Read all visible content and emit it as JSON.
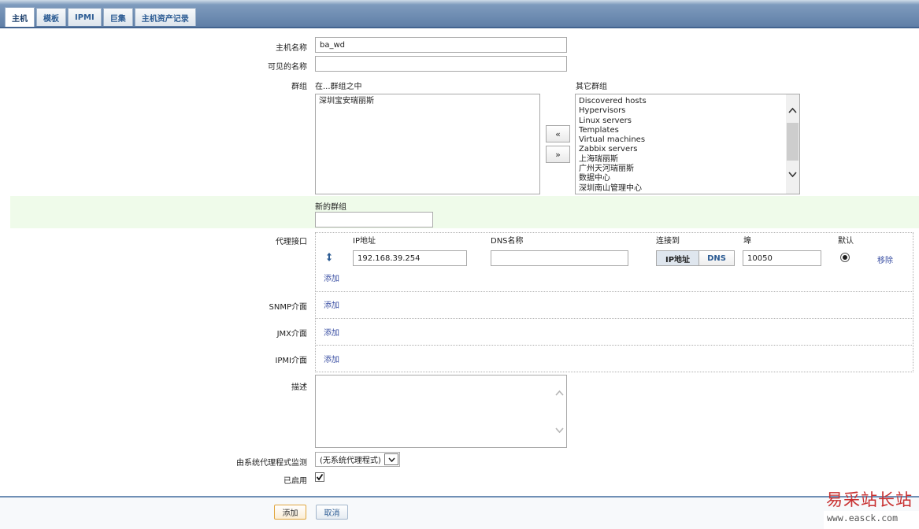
{
  "tabs": [
    "主机",
    "模板",
    "IPMI",
    "巨集",
    "主机资产记录"
  ],
  "form": {
    "host_name_label": "主机名称",
    "host_name_value": "ba_wd",
    "visible_name_label": "可见的名称",
    "visible_name_value": "",
    "groups_label": "群组",
    "in_groups_label": "在...群组之中",
    "in_groups": [
      "深圳宝安瑞丽斯"
    ],
    "other_groups_label": "其它群组",
    "other_groups": [
      "Discovered hosts",
      "Hypervisors",
      "Linux servers",
      "Templates",
      "Virtual machines",
      "Zabbix servers",
      "上海瑞丽斯",
      "广州天河瑞丽斯",
      "数据中心",
      "深圳南山管理中心"
    ],
    "move_left": "«",
    "move_right": "»",
    "new_group_label": "新的群组",
    "new_group_value": ""
  },
  "agent": {
    "label": "代理接口",
    "col_ip": "IP地址",
    "col_dns": "DNS名称",
    "col_connect": "连接到",
    "col_port": "埠",
    "col_default": "默认",
    "ip_value": "192.168.39.254",
    "dns_value": "",
    "connect_ip": "IP地址",
    "connect_dns": "DNS",
    "port_value": "10050",
    "remove": "移除",
    "add": "添加"
  },
  "snmp": {
    "label": "SNMP介面",
    "add": "添加"
  },
  "jmx": {
    "label": "JMX介面",
    "add": "添加"
  },
  "ipmi": {
    "label": "IPMI介面",
    "add": "添加"
  },
  "description_label": "描述",
  "proxy": {
    "label": "由系统代理程式监测",
    "value": "(无系统代理程式)"
  },
  "enabled_label": "已启用",
  "footer": {
    "add": "添加",
    "cancel": "取消"
  },
  "watermark": {
    "title": "易采站长站",
    "url": "www.easck.com"
  }
}
